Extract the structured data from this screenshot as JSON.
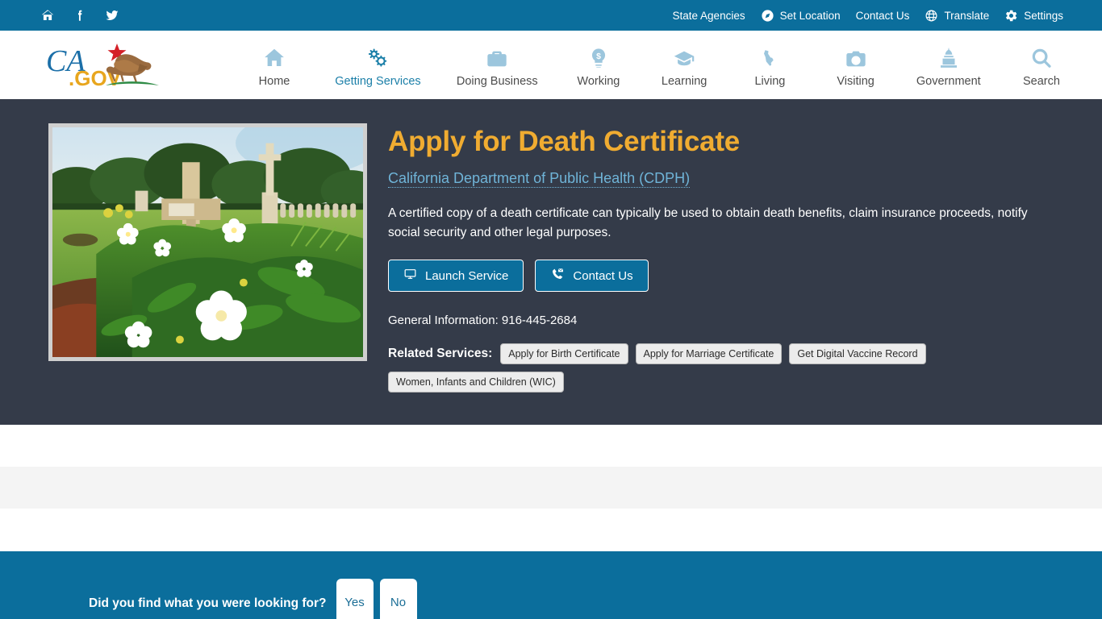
{
  "utility_bar": {
    "background": "#0b6e9c",
    "left_icons": [
      {
        "name": "home-icon",
        "glyph": "home"
      },
      {
        "name": "facebook-icon",
        "glyph": "facebook"
      },
      {
        "name": "twitter-icon",
        "glyph": "twitter"
      }
    ],
    "links": [
      {
        "label": "State Agencies",
        "icon": null
      },
      {
        "label": "Set Location",
        "icon": "compass-icon"
      },
      {
        "label": "Contact Us",
        "icon": null
      },
      {
        "label": "Translate",
        "icon": "globe-icon"
      },
      {
        "label": "Settings",
        "icon": "gear-icon"
      }
    ]
  },
  "logo": {
    "text_primary": "CA",
    "text_secondary": ".GOV",
    "alt": "CA.gov California state logo with grizzly bear and red star"
  },
  "nav": {
    "active": "Getting Services",
    "items": [
      {
        "label": "Home",
        "icon": "home-icon"
      },
      {
        "label": "Getting Services",
        "icon": "gears-icon"
      },
      {
        "label": "Doing Business",
        "icon": "briefcase-icon"
      },
      {
        "label": "Working",
        "icon": "lightbulb-dollar-icon"
      },
      {
        "label": "Learning",
        "icon": "graduation-cap-icon"
      },
      {
        "label": "Living",
        "icon": "california-state-icon"
      },
      {
        "label": "Visiting",
        "icon": "camera-icon"
      },
      {
        "label": "Government",
        "icon": "capitol-icon"
      },
      {
        "label": "Search",
        "icon": "search-icon"
      }
    ]
  },
  "hero": {
    "background": "#343b49",
    "title": "Apply for Death Certificate",
    "title_color": "#f0ac31",
    "agency_link": "California Department of Public Health (CDPH)",
    "agency_link_color": "#6fb4d8",
    "description": "A certified copy of a death certificate can typically be used to obtain death benefits, claim insurance proceeds, notify social security and other legal purposes.",
    "image_alt": "Cemetery with grave markers and white flowers in green foliage",
    "buttons": [
      {
        "label": "Launch Service",
        "icon": "monitor-icon"
      },
      {
        "label": "Contact Us",
        "icon": "phone-envelope-icon"
      }
    ],
    "general_information": "General Information: 916-445-2684",
    "related_services_label": "Related Services:",
    "related_services": [
      "Apply for Birth Certificate",
      "Apply for Marriage Certificate",
      "Get Digital Vaccine Record",
      "Women, Infants and Children (WIC)"
    ]
  },
  "feedback": {
    "question": "Did you find what you were looking for?",
    "yes_label": "Yes",
    "no_label": "No",
    "background": "#0b6e9c"
  }
}
